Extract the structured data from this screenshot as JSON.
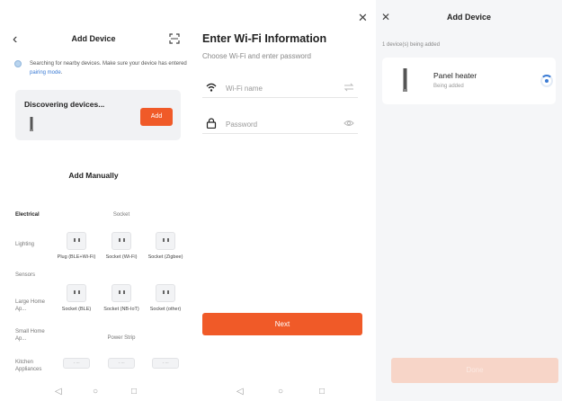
{
  "colors": {
    "accent": "#f05a28",
    "link": "#3b7bd4",
    "disabled_button": "#f7d5c8",
    "card_bg": "#f1f2f4"
  },
  "add_device_screen": {
    "title": "Add Device",
    "back_icon": "chevron-left-icon",
    "scan_icon": "scan-icon",
    "searching_text": "Searching for nearby devices. Make sure your device has entered ",
    "pairing_link": "pairing mode",
    "searching_text_end": ".",
    "discovering": {
      "title": "Discovering devices...",
      "add_label": "Add"
    },
    "add_manually": "Add Manually",
    "categories": [
      "Electrical",
      "Lighting",
      "Sensors",
      "Large Home Ap...",
      "Small Home Ap...",
      "Kitchen Appliances"
    ],
    "section_socket": "Socket",
    "devices": [
      {
        "label": "Plug (BLE+Wi-Fi)"
      },
      {
        "label": "Socket (Wi-Fi)"
      },
      {
        "label": "Socket (Zigbee)"
      },
      {
        "label": "Socket (BLE)"
      },
      {
        "label": "Socket (NB-IoT)"
      },
      {
        "label": "Socket (other)"
      }
    ],
    "section_power_strip": "Power Strip"
  },
  "wifi_screen": {
    "title": "Enter Wi-Fi Information",
    "subtitle": "Choose Wi-Fi and enter password",
    "wifi_placeholder": "Wi-Fi name",
    "password_placeholder": "Password",
    "next_label": "Next"
  },
  "adding_screen": {
    "title": "Add Device",
    "count_text": "1 device(s) being added",
    "device_name": "Panel heater",
    "device_status": "Being added",
    "done_label": "Done"
  },
  "nav": {
    "back": "◁",
    "home": "○",
    "recent": "□"
  }
}
